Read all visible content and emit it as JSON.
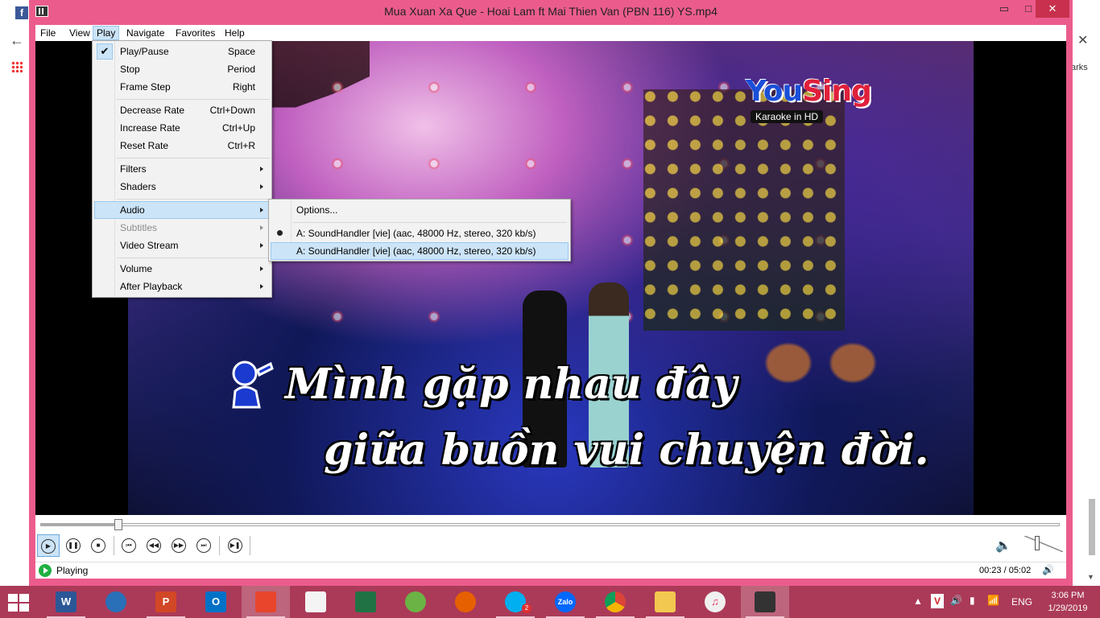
{
  "window": {
    "title": "Mua Xuan Xa Que - Hoai Lam ft Mai Thien Van (PBN 116) YS.mp4",
    "min_glyph": "▭",
    "max_glyph": "□",
    "close_glyph": "✕"
  },
  "menubar": [
    "File",
    "View",
    "Play",
    "Navigate",
    "Favorites",
    "Help"
  ],
  "play_menu": {
    "items": [
      {
        "label": "Play/Pause",
        "shortcut": "Space",
        "checked": true
      },
      {
        "label": "Stop",
        "shortcut": "Period"
      },
      {
        "label": "Frame Step",
        "shortcut": "Right"
      },
      {
        "label": "Decrease Rate",
        "shortcut": "Ctrl+Down"
      },
      {
        "label": "Increase Rate",
        "shortcut": "Ctrl+Up"
      },
      {
        "label": "Reset Rate",
        "shortcut": "Ctrl+R"
      },
      {
        "label": "Filters"
      },
      {
        "label": "Shaders"
      },
      {
        "label": "Audio"
      },
      {
        "label": "Subtitles"
      },
      {
        "label": "Video Stream"
      },
      {
        "label": "Volume"
      },
      {
        "label": "After Playback"
      }
    ]
  },
  "audio_submenu": {
    "options": "Options...",
    "tracks": [
      "A: SoundHandler [vie] (aac, 48000 Hz, stereo, 320 kb/s)",
      "A: SoundHandler [vie] (aac, 48000 Hz, stereo, 320 kb/s)"
    ]
  },
  "video": {
    "logo_you": "You",
    "logo_sing": "Sing",
    "logo_sub": "Karaoke in HD",
    "lyric_line1": "Mình gặp nhau đây",
    "lyric_line2": "giữa buồn vui chuyện đời."
  },
  "player": {
    "seek_fraction": 0.076,
    "volume_fraction": 0.3
  },
  "status": {
    "state": "Playing",
    "time": "00:23 / 05:02"
  },
  "background_browser": {
    "fb_glyph": "f",
    "back_glyph": "←",
    "close_glyph": "✕",
    "bookmarks_fragment": "arks"
  },
  "taskbar": {
    "apps": [
      "W",
      "P",
      "O",
      "Zalo"
    ],
    "language": "ENG",
    "time": "3:06 PM",
    "date": "1/29/2019",
    "skype_badge": "2"
  },
  "colors": {
    "window_frame": "#eb5c8c",
    "taskbar": "#ab3a58",
    "menu_highlight": "#cce4f7"
  }
}
